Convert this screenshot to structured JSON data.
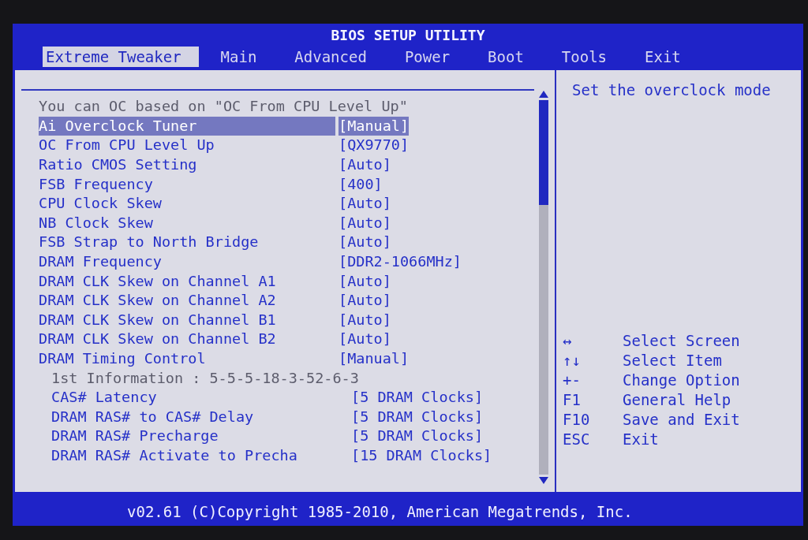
{
  "window": {
    "title": "BIOS SETUP UTILITY"
  },
  "tabs": [
    {
      "label": "Extreme Tweaker",
      "selected": true
    },
    {
      "label": "Main",
      "selected": false
    },
    {
      "label": "Advanced",
      "selected": false
    },
    {
      "label": "Power",
      "selected": false
    },
    {
      "label": "Boot",
      "selected": false
    },
    {
      "label": "Tools",
      "selected": false
    },
    {
      "label": "Exit",
      "selected": false
    }
  ],
  "settings": [
    {
      "kind": "info",
      "label": "You can OC based on \"OC From CPU Level Up\""
    },
    {
      "kind": "option",
      "label": "Ai Overclock Tuner",
      "value": "[Manual]",
      "selected": true
    },
    {
      "kind": "option",
      "label": "OC From CPU Level Up",
      "value": "[QX9770]",
      "selected": false
    },
    {
      "kind": "option",
      "label": "Ratio CMOS Setting",
      "value": "[Auto]",
      "selected": false
    },
    {
      "kind": "option",
      "label": "FSB Frequency",
      "value": "[400]",
      "selected": false
    },
    {
      "kind": "option",
      "label": "CPU Clock Skew",
      "value": "[Auto]",
      "selected": false
    },
    {
      "kind": "option",
      "label": "NB Clock Skew",
      "value": "[Auto]",
      "selected": false
    },
    {
      "kind": "option",
      "label": "FSB Strap to North Bridge",
      "value": "[Auto]",
      "selected": false
    },
    {
      "kind": "option",
      "label": "DRAM Frequency",
      "value": "[DDR2-1066MHz]",
      "selected": false
    },
    {
      "kind": "option",
      "label": "DRAM CLK Skew on Channel A1",
      "value": "[Auto]",
      "selected": false
    },
    {
      "kind": "option",
      "label": "DRAM CLK Skew on Channel A2",
      "value": "[Auto]",
      "selected": false
    },
    {
      "kind": "option",
      "label": "DRAM CLK Skew on Channel B1",
      "value": "[Auto]",
      "selected": false
    },
    {
      "kind": "option",
      "label": "DRAM CLK Skew on Channel B2",
      "value": "[Auto]",
      "selected": false
    },
    {
      "kind": "option",
      "label": "DRAM Timing Control",
      "value": "[Manual]",
      "selected": false,
      "children": [
        {
          "kind": "info",
          "label": "1st Information : 5-5-5-18-3-52-6-3"
        },
        {
          "kind": "option",
          "label": "CAS# Latency",
          "value": "[5 DRAM Clocks]",
          "selected": false
        },
        {
          "kind": "option",
          "label": "DRAM RAS# to CAS# Delay",
          "value": "[5 DRAM Clocks]",
          "selected": false
        },
        {
          "kind": "option",
          "label": "DRAM RAS# Precharge",
          "value": "[5 DRAM Clocks]",
          "selected": false
        },
        {
          "kind": "option",
          "label": "DRAM RAS# Activate to Precha",
          "value": "[15 DRAM Clocks]",
          "selected": false
        }
      ]
    }
  ],
  "help": {
    "text": "Set the overclock mode"
  },
  "keys": [
    {
      "key": "↔",
      "action": "Select Screen"
    },
    {
      "key": "↑↓",
      "action": "Select Item"
    },
    {
      "key": "+-",
      "action": "Change Option"
    },
    {
      "key": "F1",
      "action": "General Help"
    },
    {
      "key": "F10",
      "action": "Save and Exit"
    },
    {
      "key": "ESC",
      "action": "Exit"
    }
  ],
  "footer": "v02.61 (C)Copyright 1985-2010, American Megatrends, Inc."
}
